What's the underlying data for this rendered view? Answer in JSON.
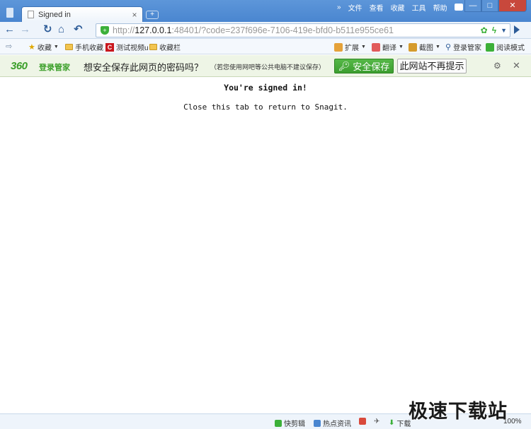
{
  "tab": {
    "title": "Signed in",
    "close": "×",
    "new_tab": "+"
  },
  "menu": {
    "more": "»",
    "file": "文件",
    "view": "查看",
    "favorites": "收藏",
    "tools": "工具",
    "help": "帮助"
  },
  "window": {
    "minimize": "—",
    "maximize": "□",
    "close": "✕"
  },
  "nav": {
    "back": "←",
    "forward": "→",
    "refresh": "↻",
    "home": "⌂",
    "undo": "↶"
  },
  "address": {
    "host": "127.0.0.1",
    "rest": ":48401/?code=237f696e-7106-419e-bfd0-b511e955ce61"
  },
  "bookmarks": {
    "items": [
      "收藏",
      "手机收藏",
      "测试视频u",
      "收藏栏"
    ],
    "right": [
      "扩展",
      "翻译",
      "截图",
      "登录管家",
      "阅读模式"
    ]
  },
  "password_bar": {
    "logo_num": "360",
    "logo_text": "登录管家",
    "question": "想安全保存此网页的密码吗？",
    "hint": "（若您使用网吧等公共电脑不建议保存）",
    "save_label": "安全保存",
    "never_label": "此网站不再提示"
  },
  "content": {
    "heading": "You're signed in!",
    "message": "Close this tab to return to Snagit."
  },
  "status": {
    "items": [
      "快剪辑",
      "热点资讯",
      "下载"
    ],
    "zoom": "100%"
  },
  "watermark": "极速下载站",
  "colors": {
    "accent": "#4a86d0",
    "green": "#3b9f2a"
  }
}
